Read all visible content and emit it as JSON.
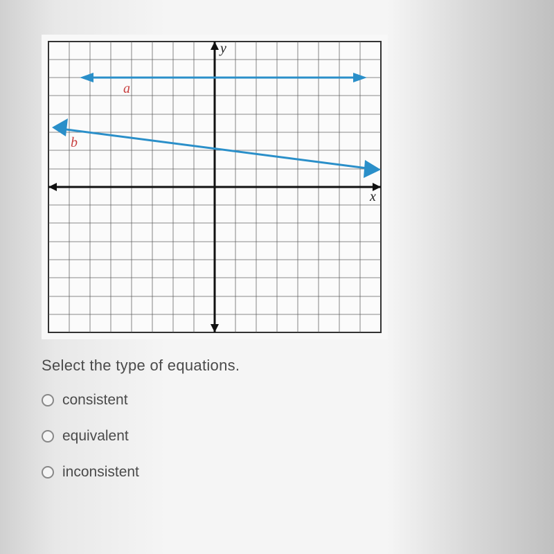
{
  "axes": {
    "y_label": "y",
    "x_label": "x"
  },
  "line_labels": {
    "a": "a",
    "b": "b"
  },
  "question": "Select the type of equations.",
  "options": [
    {
      "id": "consistent",
      "label": "consistent"
    },
    {
      "id": "equivalent",
      "label": "equivalent"
    },
    {
      "id": "inconsistent",
      "label": "inconsistent"
    }
  ],
  "chart_data": {
    "type": "line",
    "title": "",
    "xlabel": "x",
    "ylabel": "y",
    "xlim": [
      -8,
      8
    ],
    "ylim": [
      -8,
      8
    ],
    "grid": true,
    "series": [
      {
        "name": "a",
        "x": [
          -8,
          8
        ],
        "y": [
          6,
          6
        ],
        "color": "#2a8fc9"
      },
      {
        "name": "b",
        "x": [
          -8,
          8
        ],
        "y": [
          3.2,
          1
        ],
        "color": "#2a8fc9"
      }
    ]
  }
}
